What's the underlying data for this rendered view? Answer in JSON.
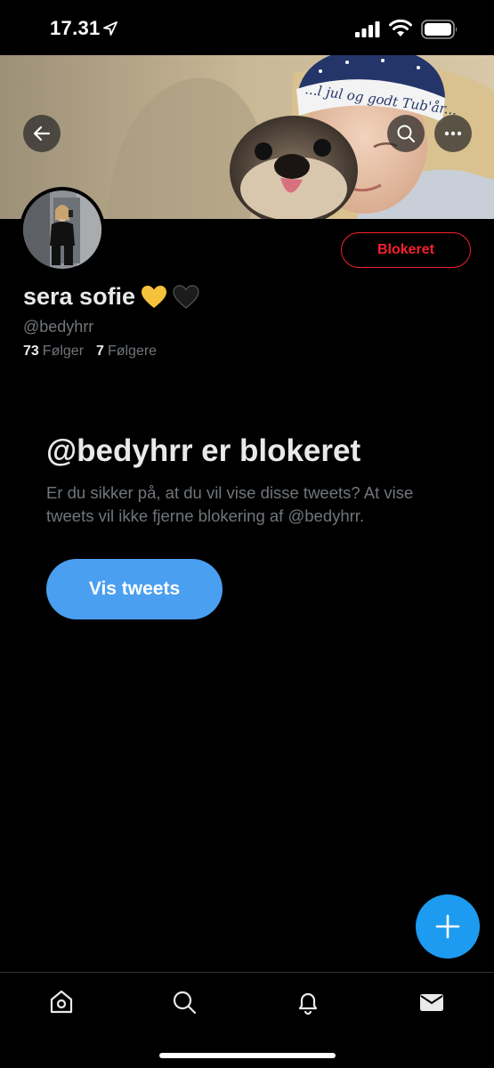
{
  "status_bar": {
    "time": "17.31"
  },
  "banner": {
    "hat_text": "...l jul og godt Tub'år..."
  },
  "profile": {
    "display_name": "sera sofie",
    "handle": "@bedyhrr",
    "following_count": "73",
    "following_label": "Følger",
    "followers_count": "7",
    "followers_label": "Følgere",
    "blocked_button_label": "Blokeret"
  },
  "notice": {
    "title": "@bedyhrr er blokeret",
    "description": "Er du sikker på, at du vil vise disse tweets? At vise tweets vil ikke fjerne blokering af @bedyhrr.",
    "button_label": "Vis tweets"
  },
  "colors": {
    "background": "#000000",
    "accent": "#1d9bf0",
    "button_blue": "#4a9ff0",
    "danger": "#f4212e",
    "secondary_text": "#71767b"
  },
  "icons": {
    "status": [
      "location-arrow-icon",
      "signal-icon",
      "wifi-icon",
      "battery-icon"
    ],
    "header": [
      "back-arrow-icon",
      "search-icon",
      "more-icon"
    ],
    "nav": [
      "home-icon",
      "search-icon",
      "bell-icon",
      "mail-icon"
    ],
    "fab": "plus-icon"
  }
}
